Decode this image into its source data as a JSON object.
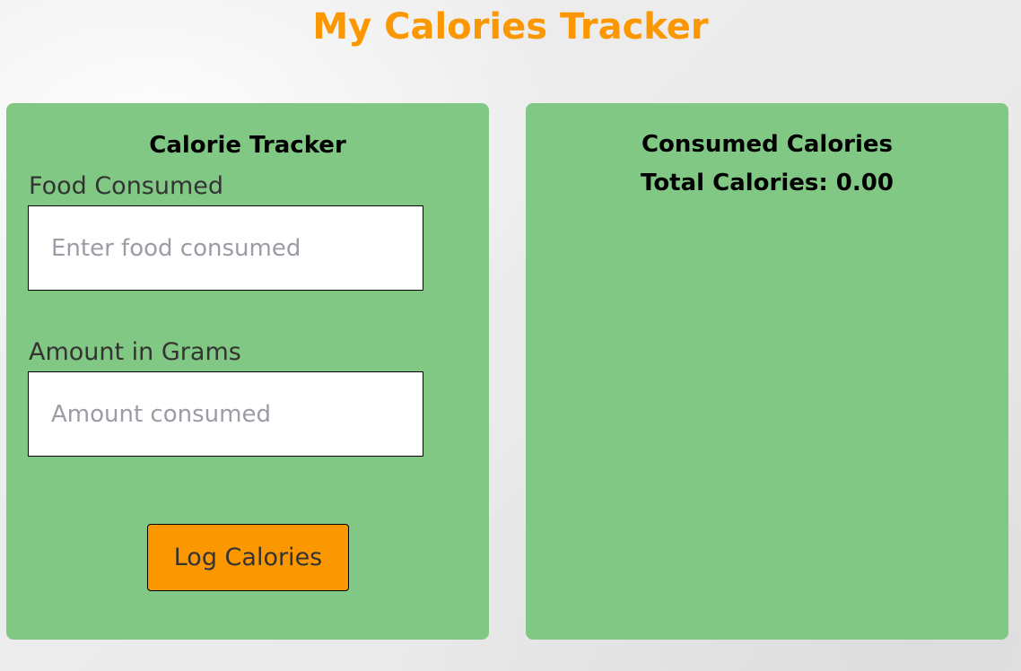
{
  "page": {
    "title": "My Calories Tracker"
  },
  "tracker_panel": {
    "heading": "Calorie Tracker",
    "food_label": "Food Consumed",
    "food_placeholder": "Enter food consumed",
    "food_value": "",
    "amount_label": "Amount in Grams",
    "amount_placeholder": "Amount consumed",
    "amount_value": "",
    "log_button_label": "Log Calories"
  },
  "consumed_panel": {
    "heading": "Consumed Calories",
    "total_text": "Total Calories: 0.00"
  },
  "colors": {
    "accent_orange": "#fb9700",
    "panel_green": "#80c883"
  }
}
